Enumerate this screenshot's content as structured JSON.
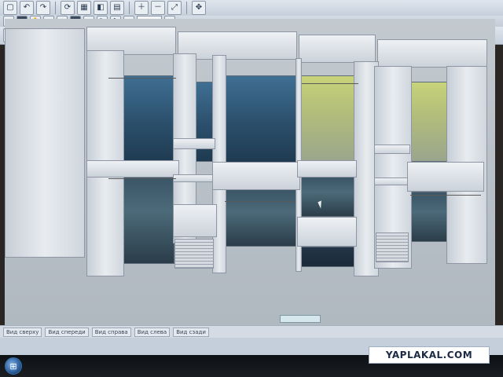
{
  "toolbar_top": {
    "buttons": [
      "select-icon",
      "undo-icon",
      "redo-icon",
      "rotate-icon",
      "grid-icon",
      "zoom-icon",
      "zoom-extents-icon",
      "pan-icon"
    ],
    "zoom_value": ""
  },
  "toolbar_bottom": {
    "buttons": [
      "pencil-icon",
      "move-icon",
      "copy-icon",
      "mirror-icon",
      "settings-icon",
      "measure-icon",
      "dimension-icon"
    ]
  },
  "view_tabs": [
    "Вид сверху",
    "Вид спереди",
    "Вид справа",
    "Вид слева",
    "Вид сзади"
  ],
  "watermark": "YAPLAKAL.COM",
  "start_button": "start-orb-icon"
}
